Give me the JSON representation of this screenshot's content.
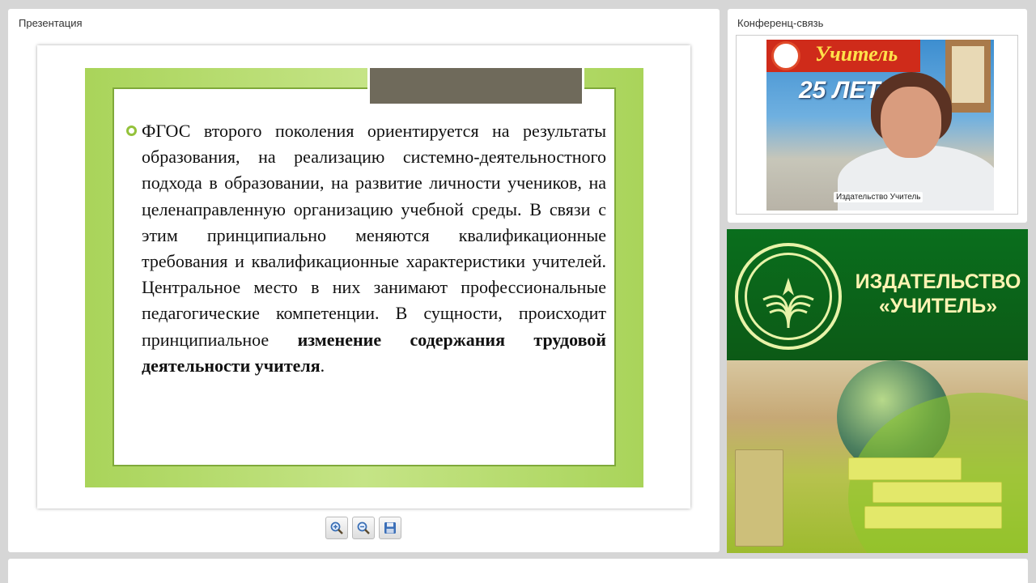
{
  "presentation": {
    "title": "Презентация",
    "slide": {
      "paragraph_plain": "ФГОС второго поколения ориентируется на результаты образования, на реализацию системно-деятельностного подхода в образовании, на развитие личности учеников, на целенаправленную организацию учебной среды. В связи с этим принципиально меняются квалификационные требования и квалификационные характеристики учителей. Центральное место в них занимают профессиональные педагогические компетенции. В сущности, происходит принципиальное ",
      "paragraph_bold": "изменение содержания трудовой деятельности учителя",
      "paragraph_end": "."
    },
    "toolbar": {
      "zoom_in_icon": "zoom-in-icon",
      "zoom_out_icon": "zoom-out-icon",
      "save_icon": "floppy-disk-icon"
    }
  },
  "conference": {
    "title": "Конференц-связь",
    "video": {
      "participant_label": "Издательство Учитель",
      "background_sign": "Учитель",
      "background_years": "25 ЛЕТ"
    }
  },
  "banner": {
    "title_line1": "ИЗДАТЕЛЬСТВО",
    "title_line2": "«УЧИТЕЛЬ»"
  },
  "colors": {
    "slide_green": "#a9d45a",
    "banner_green": "#0a6e1d",
    "banner_text": "#fff4b3"
  }
}
